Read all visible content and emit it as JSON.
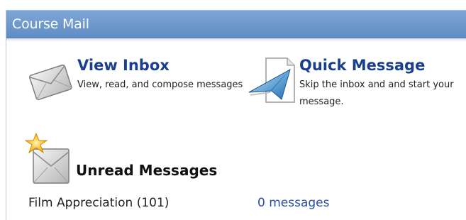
{
  "panel": {
    "title": "Course Mail"
  },
  "actions": [
    {
      "id": "view-inbox",
      "title": "View Inbox",
      "description": "View, read, and compose messages",
      "icon": "envelope-icon"
    },
    {
      "id": "quick-message",
      "title": "Quick Message",
      "description": "Skip the inbox and and start your message.",
      "icon": "paper-airplane-document-icon"
    }
  ],
  "unread": {
    "title": "Unread Messages",
    "icon": "new-mail-star-icon",
    "courses": [
      {
        "name": "Film Appreciation (101)",
        "count_label": "0 messages"
      }
    ]
  },
  "colors": {
    "header_bg": "#6b97cd",
    "link": "#1a3f8f",
    "count_link": "#2a4fa8"
  }
}
